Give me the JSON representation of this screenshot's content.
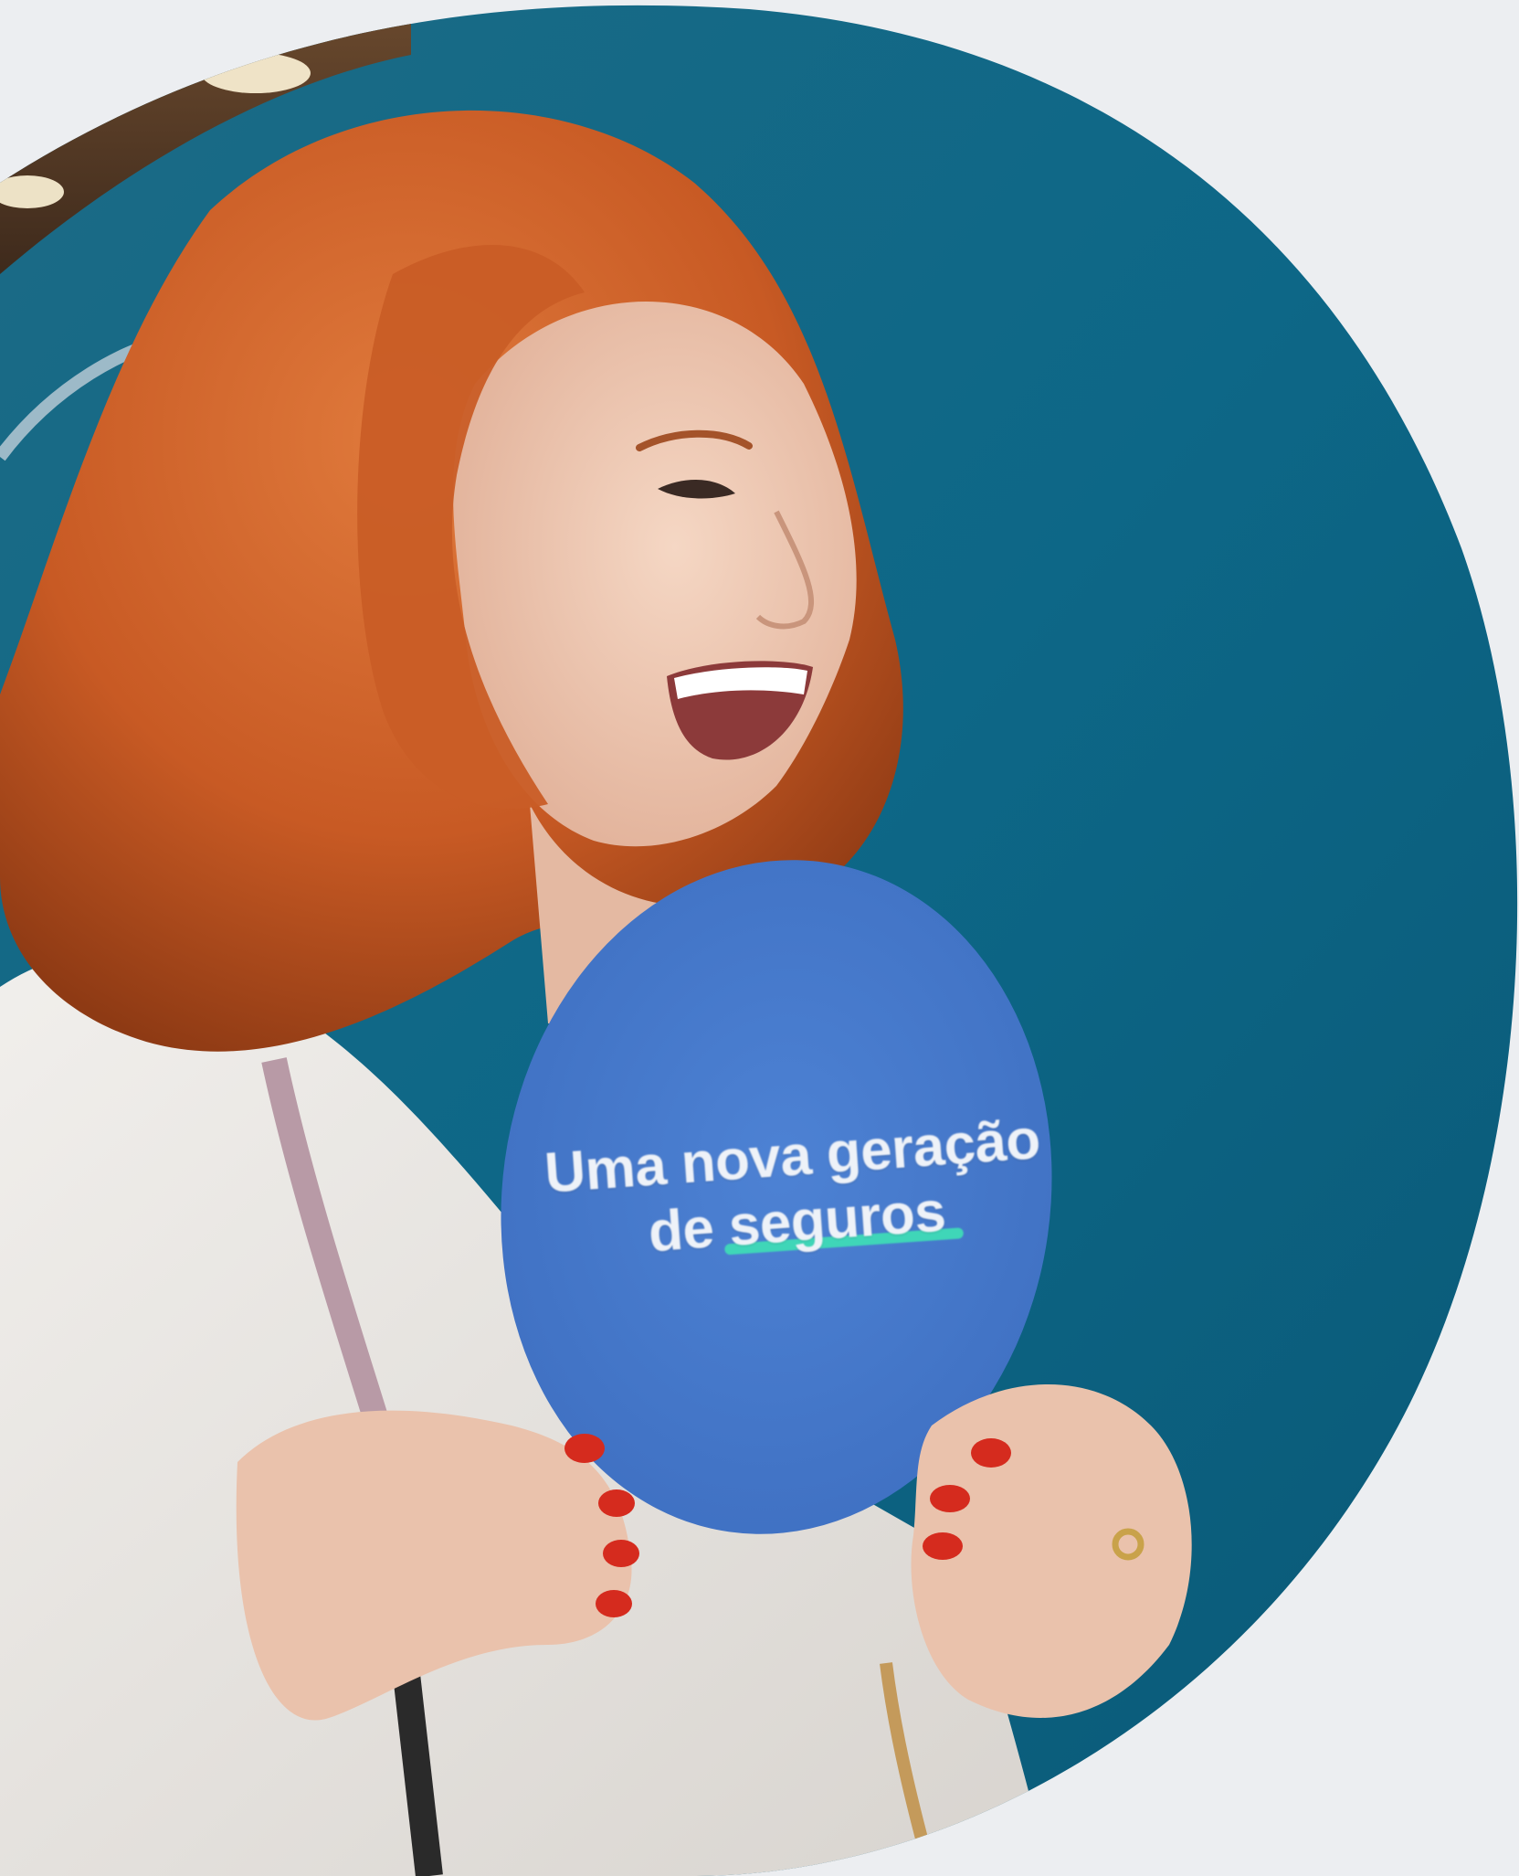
{
  "photo": {
    "subject": "woman-holding-sign",
    "background_color": "#eceef1",
    "wall_color": "#0f6a8c",
    "sign_color": "#4a7fd0",
    "accent_color": "#3fd6b8"
  },
  "sign": {
    "line1": "Uma nova geração",
    "line2_prefix": "de",
    "line2_highlight": "seguros"
  }
}
